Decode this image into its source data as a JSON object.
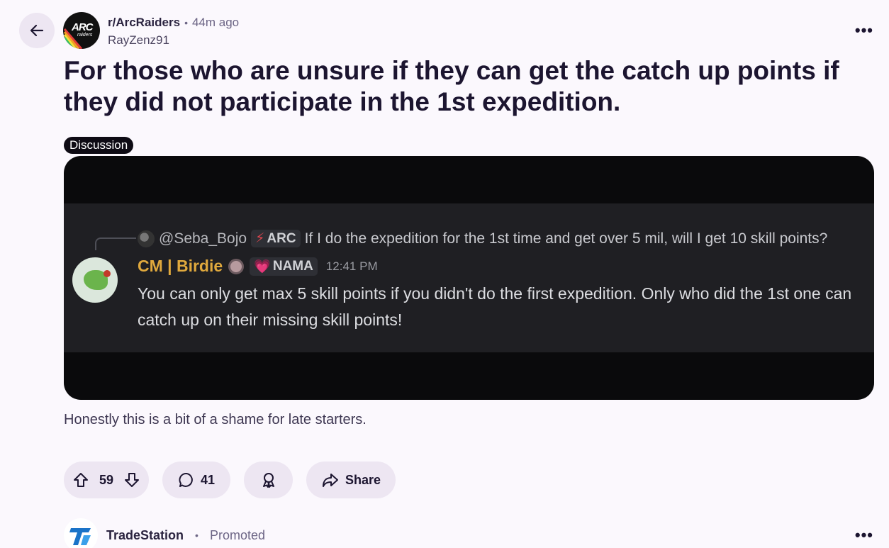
{
  "post": {
    "subreddit": "r/ArcRaiders",
    "separator": "•",
    "time_ago": "44m ago",
    "author": "RayZenz91",
    "title": "For those who are unsure if they can get the catch up points if they did not participate in the 1st expedition.",
    "flair": "Discussion",
    "body": "Honestly this is a bit of a shame for late starters.",
    "more_label": "•••"
  },
  "subreddit_logo": {
    "text": "ARC",
    "subtext": "raiders"
  },
  "discord": {
    "reply_user": "@Seba_Bojo",
    "reply_tag_icon": "⚡",
    "reply_tag": "ARC",
    "reply_text": "If I do the expedition for the 1st time and get over 5 mil, will I get 10 skill points?",
    "author_name": "CM | Birdie",
    "author_tag_icon": "💗",
    "author_tag": "NAMA",
    "timestamp": "12:41 PM",
    "message": "You can only get max 5 skill points if you didn't do the first expedition. Only who did the 1st one can catch up on their missing skill points!"
  },
  "actions": {
    "upvotes": "59",
    "comments": "41",
    "share_label": "Share"
  },
  "ad": {
    "name": "TradeStation",
    "separator": "•",
    "label": "Promoted",
    "more_label": "•••"
  },
  "colors": {
    "page_bg": "#fbf8fd",
    "pill_bg": "#ede6f2",
    "discord_bg": "#1f1f23",
    "cm_name": "#e0a93d",
    "tradestation_blue": "#1a73c8"
  },
  "icons": {
    "back": "arrow-left-icon",
    "upvote": "arrow-up-icon",
    "downvote": "arrow-down-icon",
    "comment": "chat-bubble-icon",
    "award": "award-icon",
    "share": "share-arrow-icon"
  }
}
